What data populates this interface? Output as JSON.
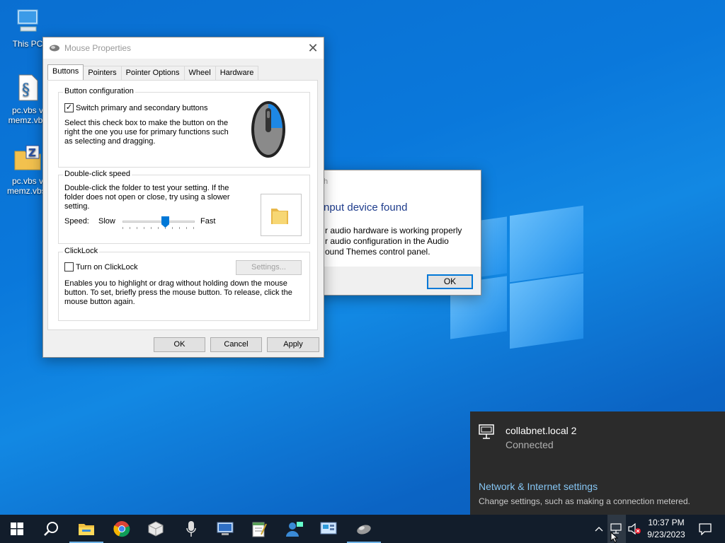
{
  "desktop": {
    "icons": [
      {
        "label": "This PC",
        "icon": "computer-icon"
      },
      {
        "label1": "pc.vbs v",
        "label2": "memz.vbs",
        "icon": "script-file-icon"
      },
      {
        "label1": "pc.vbs v",
        "label2": "memz.vbs.",
        "icon": "zip-folder-icon"
      }
    ]
  },
  "mouse_dialog": {
    "title": "Mouse Properties",
    "tabs": [
      "Buttons",
      "Pointers",
      "Pointer Options",
      "Wheel",
      "Hardware"
    ],
    "active_tab": "Buttons",
    "button_config": {
      "title": "Button configuration",
      "checkbox_label": "Switch primary and secondary buttons",
      "checked": true,
      "check_mark": "✓",
      "desc1": "Select this check box to make the button on the",
      "desc2": "right the one you use for primary functions such",
      "desc3": "as selecting and dragging."
    },
    "double_click": {
      "title": "Double-click speed",
      "desc1": "Double-click the folder to test your setting. If the",
      "desc2": "folder does not open or close, try using a slower",
      "desc3": "setting.",
      "speed_label": "Speed:",
      "slow_label": "Slow",
      "fast_label": "Fast",
      "speed_level": 0.6
    },
    "clicklock": {
      "title": "ClickLock",
      "checkbox_label": "Turn on ClickLock",
      "checked": false,
      "settings_label": "Settings...",
      "desc1": "Enables you to highlight or drag without holding down the mouse",
      "desc2": "button. To set, briefly press the mouse button. To release, click the",
      "desc3": "mouse button again."
    },
    "buttons": {
      "ok": "OK",
      "cancel": "Cancel",
      "apply": "Apply"
    }
  },
  "bg_dialog": {
    "heading_partial": "nput device found",
    "title_partial": "h",
    "line1": "r audio hardware is working properly",
    "line2": "r audio configuration in the Audio",
    "line3": "ound Themes control panel.",
    "ok": "OK"
  },
  "network_flyout": {
    "network_name": "collabnet.local 2",
    "status": "Connected",
    "settings_link": "Network & Internet settings",
    "settings_desc": "Change settings, such as making a connection metered."
  },
  "taskbar": {
    "time": "10:37 PM",
    "date": "9/23/2023"
  },
  "colors": {
    "accent": "#0078d7",
    "taskbar": "#121d2b",
    "flyout": "#2b2b2b"
  }
}
